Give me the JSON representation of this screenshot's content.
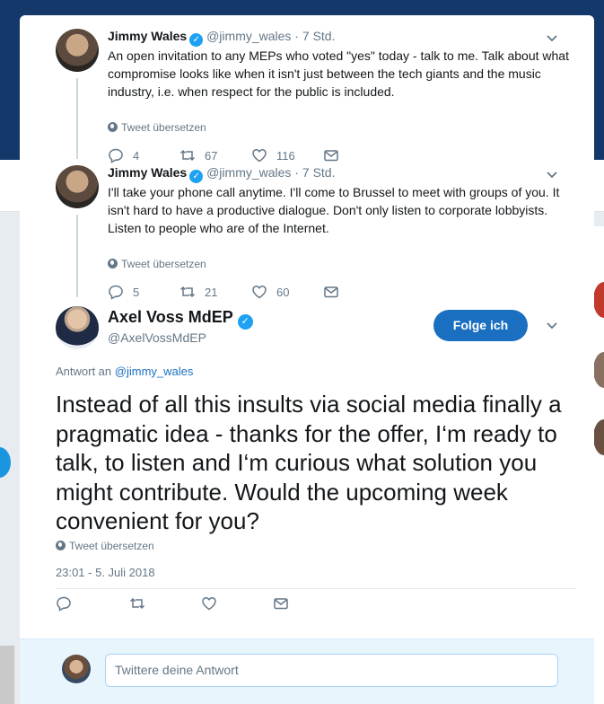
{
  "thread": [
    {
      "name": "Jimmy Wales",
      "handle": "@jimmy_wales",
      "time": "7 Std.",
      "text": "An open invitation to any MEPs who voted \"yes\" today - talk to me.  Talk about what compromise looks like when it isn't just between the tech giants and the music industry, i.e. when respect for the public is included.",
      "translate": "Tweet übersetzen",
      "replies": "4",
      "retweets": "67",
      "likes": "116"
    },
    {
      "name": "Jimmy Wales",
      "handle": "@jimmy_wales",
      "time": "7 Std.",
      "text": "I'll take your phone call anytime.  I'll come to Brussel to meet with groups of you.  It isn't hard to have a productive dialogue.  Don't only listen to corporate lobbyists.  Listen to people who are of the Internet.",
      "translate": "Tweet übersetzen",
      "replies": "5",
      "retweets": "21",
      "likes": "60"
    }
  ],
  "main": {
    "name": "Axel Voss MdEP",
    "handle": "@AxelVossMdEP",
    "follow_label": "Folge ich",
    "reply_prefix": "Antwort an",
    "reply_to": "@jimmy_wales",
    "text": "Instead of all this insults via social media finally a pragmatic idea - thanks for the offer, I‘m ready to talk, to listen and I‘m curious what solution you might contribute. Would the upcoming week convenient for you?",
    "translate": "Tweet übersetzen",
    "timestamp": "23:01 - 5. Juli 2018"
  },
  "reply_box": {
    "placeholder": "Twittere deine Antwort"
  },
  "sep": "·",
  "colors": {
    "accent": "#1b6fc1",
    "verified": "#1da1f2",
    "muted": "#657786",
    "header_bg": "#15386b"
  },
  "icons": [
    "reply-icon",
    "retweet-icon",
    "like-icon",
    "message-icon",
    "chevron-down-icon",
    "globe-icon",
    "verified-icon"
  ]
}
